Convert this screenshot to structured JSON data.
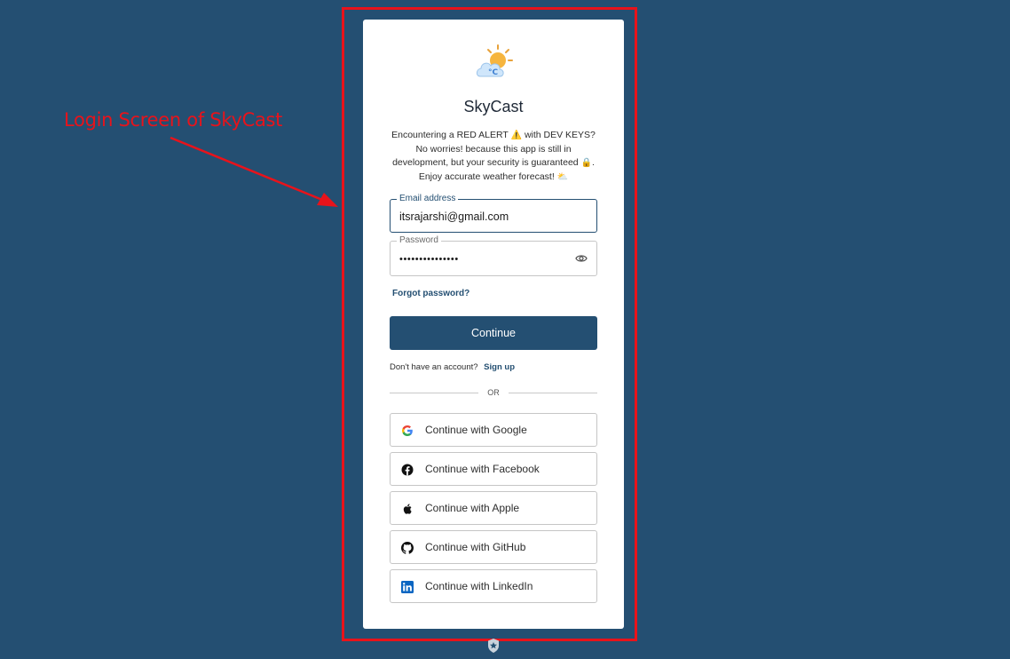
{
  "annotation": {
    "label": "Login Screen of SkyCast",
    "color": "#e8131b"
  },
  "app": {
    "title": "SkyCast",
    "logo_icon": "weather-cloud-sun-icon"
  },
  "notice": {
    "line1_a": "Encountering a RED ALERT",
    "line1_emoji": "⚠️",
    "line1_b": "with DEV KEYS?",
    "line2": "No worries! because this app is still in",
    "line3_a": "development, but your security is guaranteed",
    "line3_emoji": "🔒",
    "line3_b": ".",
    "line4_a": "Enjoy accurate weather forecast!",
    "line4_emoji": "⛅"
  },
  "form": {
    "email_label": "Email address",
    "email_value": "itsrajarshi@gmail.com",
    "password_label": "Password",
    "password_value": "•••••••••••••••",
    "forgot_label": "Forgot password?",
    "continue_label": "Continue",
    "signup_prompt": "Don't have an account?",
    "signup_label": "Sign up",
    "or_label": "OR"
  },
  "social": [
    {
      "label": "Continue with Google",
      "icon": "google-icon"
    },
    {
      "label": "Continue with Facebook",
      "icon": "facebook-icon"
    },
    {
      "label": "Continue with Apple",
      "icon": "apple-icon"
    },
    {
      "label": "Continue with GitHub",
      "icon": "github-icon"
    },
    {
      "label": "Continue with LinkedIn",
      "icon": "linkedin-icon"
    }
  ],
  "colors": {
    "background": "#244f72",
    "primary": "#244f72",
    "card": "#ffffff"
  }
}
